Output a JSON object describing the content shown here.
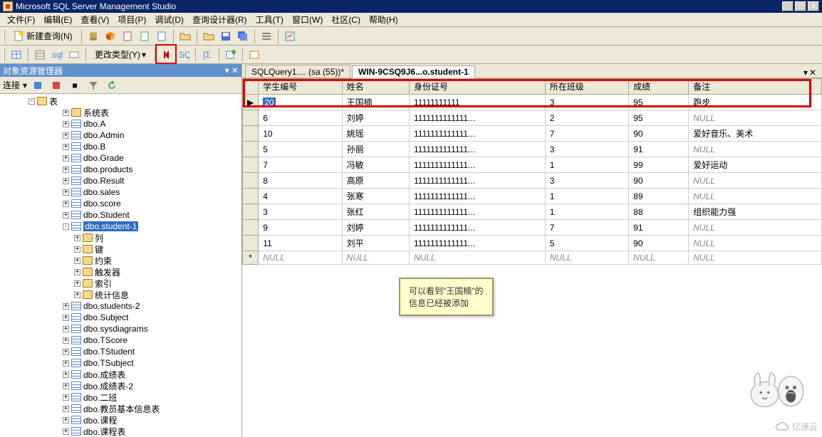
{
  "title": "Microsoft SQL Server Management Studio",
  "menu": [
    "文件(F)",
    "编辑(E)",
    "查看(V)",
    "项目(P)",
    "调试(D)",
    "查询设计器(R)",
    "工具(T)",
    "窗口(W)",
    "社区(C)",
    "帮助(H)"
  ],
  "toolbar1": {
    "new_query": "新建查询(N)"
  },
  "toolbar2": {
    "change_type": "更改类型(Y)"
  },
  "panel": {
    "title": "对象资源管理器",
    "connect": "连接"
  },
  "tree": {
    "root": "表",
    "nodes": [
      {
        "label": "系统表",
        "icon": "folder",
        "exp": "+",
        "indent": 3
      },
      {
        "label": "dbo.A",
        "icon": "table",
        "exp": "+",
        "indent": 3
      },
      {
        "label": "dbo.Admin",
        "icon": "table",
        "exp": "+",
        "indent": 3
      },
      {
        "label": "dbo.B",
        "icon": "table",
        "exp": "+",
        "indent": 3
      },
      {
        "label": "dbo.Grade",
        "icon": "table",
        "exp": "+",
        "indent": 3
      },
      {
        "label": "dbo.products",
        "icon": "table",
        "exp": "+",
        "indent": 3
      },
      {
        "label": "dbo.Result",
        "icon": "table",
        "exp": "+",
        "indent": 3
      },
      {
        "label": "dbo.sales",
        "icon": "table",
        "exp": "+",
        "indent": 3
      },
      {
        "label": "dbo.score",
        "icon": "table",
        "exp": "+",
        "indent": 3
      },
      {
        "label": "dbo.Student",
        "icon": "table",
        "exp": "+",
        "indent": 3
      },
      {
        "label": "dbo.student-1",
        "icon": "table",
        "exp": "-",
        "indent": 3,
        "selected": true
      },
      {
        "label": "列",
        "icon": "folder",
        "exp": "+",
        "indent": 4
      },
      {
        "label": "键",
        "icon": "folder",
        "exp": "+",
        "indent": 4
      },
      {
        "label": "约束",
        "icon": "folder",
        "exp": "+",
        "indent": 4
      },
      {
        "label": "触发器",
        "icon": "folder",
        "exp": "+",
        "indent": 4
      },
      {
        "label": "索引",
        "icon": "folder",
        "exp": "+",
        "indent": 4
      },
      {
        "label": "统计信息",
        "icon": "folder",
        "exp": "+",
        "indent": 4
      },
      {
        "label": "dbo.students-2",
        "icon": "table",
        "exp": "+",
        "indent": 3
      },
      {
        "label": "dbo.Subject",
        "icon": "table",
        "exp": "+",
        "indent": 3
      },
      {
        "label": "dbo.sysdiagrams",
        "icon": "table",
        "exp": "+",
        "indent": 3
      },
      {
        "label": "dbo.TScore",
        "icon": "table",
        "exp": "+",
        "indent": 3
      },
      {
        "label": "dbo.TStudent",
        "icon": "table",
        "exp": "+",
        "indent": 3
      },
      {
        "label": "dbo.TSubject",
        "icon": "table",
        "exp": "+",
        "indent": 3
      },
      {
        "label": "dbo.成绩表",
        "icon": "table",
        "exp": "+",
        "indent": 3
      },
      {
        "label": "dbo.成绩表-2",
        "icon": "table",
        "exp": "+",
        "indent": 3
      },
      {
        "label": "dbo.二班",
        "icon": "table",
        "exp": "+",
        "indent": 3
      },
      {
        "label": "dbo.教员基本信息表",
        "icon": "table",
        "exp": "+",
        "indent": 3
      },
      {
        "label": "dbo.课程",
        "icon": "table",
        "exp": "+",
        "indent": 3
      },
      {
        "label": "dbo.课程表",
        "icon": "table",
        "exp": "+",
        "indent": 3
      }
    ]
  },
  "tabs": [
    {
      "label": "SQLQuery1.... (sa (55))*",
      "active": false
    },
    {
      "label": "WIN-9CSQ9J6...o.student-1",
      "active": true
    }
  ],
  "grid": {
    "columns": [
      "学生编号",
      "姓名",
      "身份证号",
      "所在班级",
      "成绩",
      "备注"
    ],
    "rows": [
      {
        "hdr": "▶",
        "cells": [
          "20",
          "王国楠",
          "11111111111",
          "3",
          "95",
          "跑步"
        ],
        "sel": true,
        "highlight": true
      },
      {
        "hdr": "",
        "cells": [
          "6",
          "刘婷",
          "1111111111111...",
          "2",
          "95",
          "NULL"
        ]
      },
      {
        "hdr": "",
        "cells": [
          "10",
          "姚瑶",
          "1111111111111...",
          "7",
          "90",
          "爱好音乐、美术"
        ]
      },
      {
        "hdr": "",
        "cells": [
          "5",
          "孙丽",
          "1111111111111...",
          "3",
          "91",
          "NULL"
        ]
      },
      {
        "hdr": "",
        "cells": [
          "7",
          "冯敏",
          "1111111111111...",
          "1",
          "99",
          "爱好运动"
        ]
      },
      {
        "hdr": "",
        "cells": [
          "8",
          "高原",
          "1111111111111...",
          "3",
          "90",
          "NULL"
        ]
      },
      {
        "hdr": "",
        "cells": [
          "4",
          "张寒",
          "1111111111111...",
          "1",
          "89",
          "NULL"
        ]
      },
      {
        "hdr": "",
        "cells": [
          "3",
          "张红",
          "1111111111111...",
          "1",
          "88",
          "组织能力强"
        ]
      },
      {
        "hdr": "",
        "cells": [
          "9",
          "刘婷",
          "1111111111111...",
          "7",
          "91",
          "NULL"
        ]
      },
      {
        "hdr": "",
        "cells": [
          "11",
          "刘平",
          "1111111111111...",
          "5",
          "90",
          "NULL"
        ]
      },
      {
        "hdr": "*",
        "cells": [
          "NULL",
          "NULL",
          "NULL",
          "NULL",
          "NULL",
          "NULL"
        ],
        "newrow": true
      }
    ]
  },
  "callout": {
    "line1": "可以看到\"王国楠\"的",
    "line2": "信息已经被添加"
  },
  "watermark": "亿速云"
}
